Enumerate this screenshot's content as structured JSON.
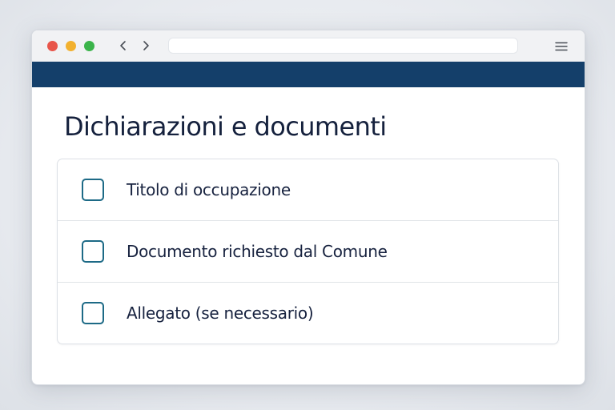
{
  "browser": {
    "address": "",
    "icons": {
      "back": "chevron-left-icon",
      "forward": "chevron-right-icon",
      "menu": "hamburger-menu-icon"
    },
    "traffic_lights": {
      "close": "#e8554a",
      "minimize": "#f2b12f",
      "maximize": "#3bb44a"
    }
  },
  "theme": {
    "banner_color": "#143f6a",
    "checkbox_color": "#1d6a86",
    "title_color": "#15213d"
  },
  "page": {
    "title": "Dichiarazioni e documenti"
  },
  "checklist": {
    "items": [
      {
        "label": "Titolo di occupazione",
        "checked": false
      },
      {
        "label": "Documento richiesto dal Comune",
        "checked": false
      },
      {
        "label": "Allegato (se necessario)",
        "checked": false
      }
    ]
  }
}
